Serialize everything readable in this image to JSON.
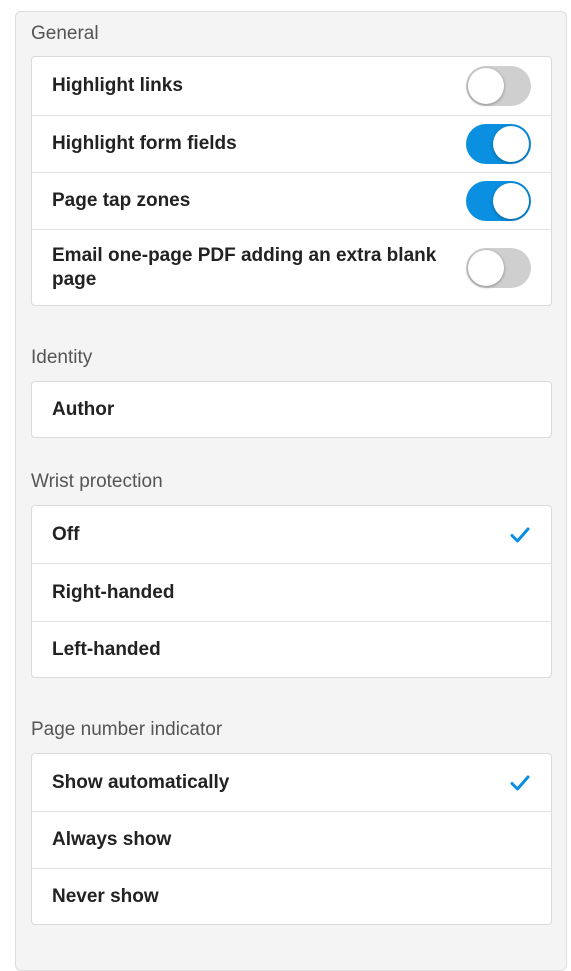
{
  "colors": {
    "accent": "#0b8fe0",
    "toggle_off": "#cfcfcf",
    "panel_bg": "#f4f4f4"
  },
  "general": {
    "title": "General",
    "items": [
      {
        "label": "Highlight links",
        "toggle": "off"
      },
      {
        "label": "Highlight form fields",
        "toggle": "on"
      },
      {
        "label": "Page tap zones",
        "toggle": "on"
      },
      {
        "label": "Email one-page PDF adding an extra blank page",
        "toggle": "off"
      }
    ]
  },
  "identity": {
    "title": "Identity",
    "items": [
      {
        "label": "Author"
      }
    ]
  },
  "wrist_protection": {
    "title": "Wrist protection",
    "items": [
      {
        "label": "Off",
        "selected": true
      },
      {
        "label": "Right-handed",
        "selected": false
      },
      {
        "label": "Left-handed",
        "selected": false
      }
    ]
  },
  "page_number_indicator": {
    "title": "Page number indicator",
    "items": [
      {
        "label": "Show automatically",
        "selected": true
      },
      {
        "label": "Always show",
        "selected": false
      },
      {
        "label": "Never show",
        "selected": false
      }
    ]
  },
  "icons": {
    "checkmark": "checkmark-icon"
  }
}
